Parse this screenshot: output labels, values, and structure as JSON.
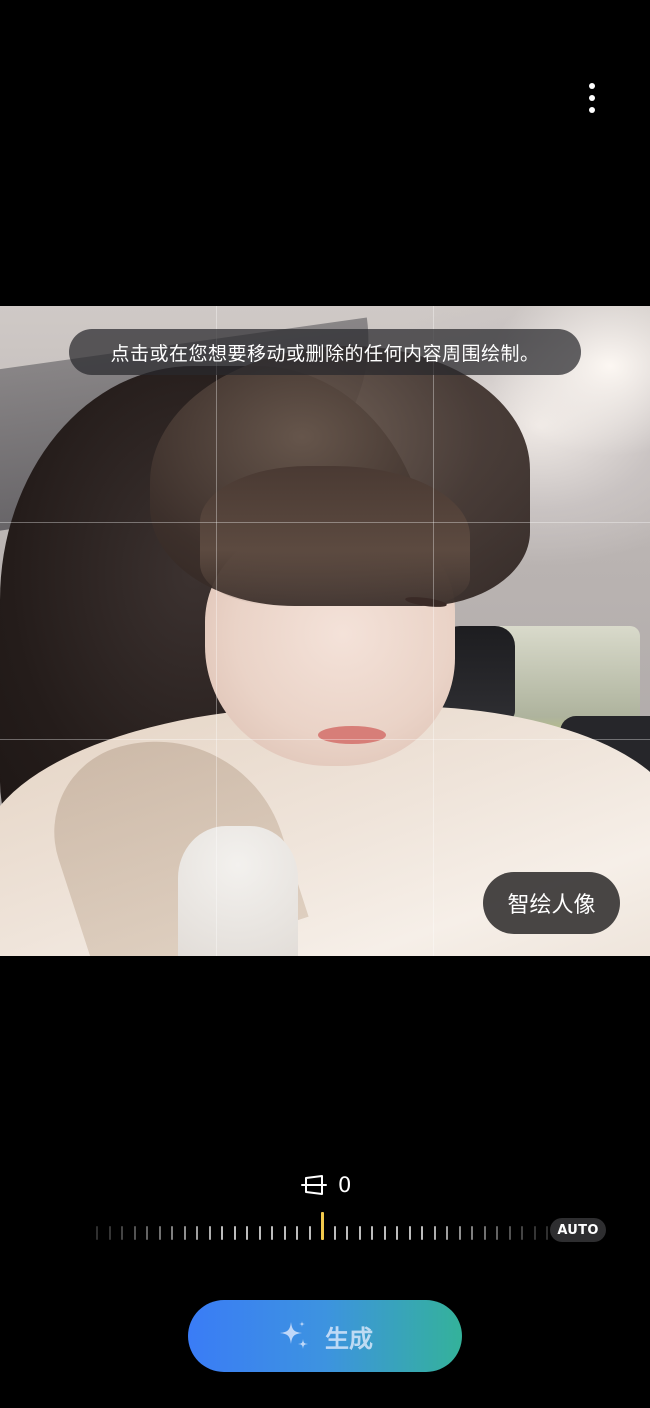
{
  "toolbar": {
    "more_icon": "more-vertical-icon"
  },
  "photo": {
    "hint_text": "点击或在您想要移动或删除的任何内容周围绘制。",
    "portrait_button_label": "智绘人像"
  },
  "adjustment": {
    "icon": "rotate-tilt-icon",
    "value": "0",
    "auto_label": "AUTO",
    "tick_count": 37,
    "center_tick_index": 18,
    "accent_color": "#f2c94c"
  },
  "generate": {
    "label": "生成",
    "icon": "sparkle-icon",
    "gradient_start": "#3a7cf6",
    "gradient_end": "#34b29a"
  }
}
